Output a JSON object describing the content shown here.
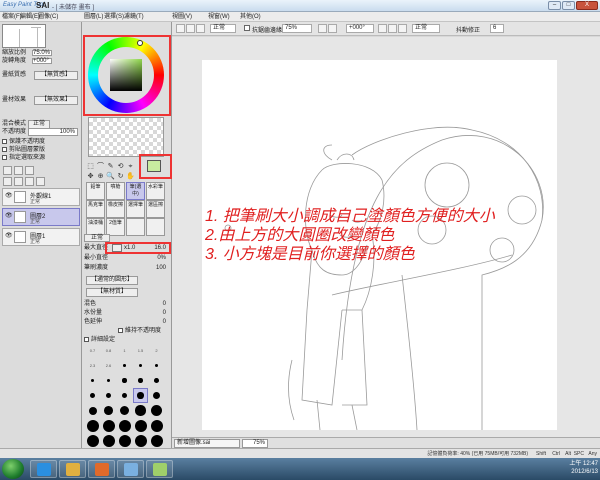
{
  "titlebar": {
    "logo": "Easy Paint Tool",
    "app": "SAI",
    "doc": "- [ 未儲存 畫布 ]",
    "minimize": "–",
    "maximize": "□",
    "close": "X"
  },
  "menu": {
    "items": [
      "檔案(F)",
      "編輯(E)",
      "圖像(C)",
      "圖層(L)",
      "選擇(S)",
      "濾鏡(T)",
      "視圖(V)",
      "視窗(W)",
      "其他(O)"
    ]
  },
  "toolbar": {
    "selection_mode": "正常",
    "antialias_label": "抗鋸齒邊緣",
    "zoom": "75%",
    "angle": "+000°",
    "mode2": "正常",
    "stabilizer_label": "抖動修正",
    "stabilizer_value": "6"
  },
  "left_panel": {
    "nav_zoom_label": "縮放比例",
    "nav_zoom_value": "75.0%",
    "nav_angle_label": "旋轉角度",
    "nav_angle_value": "+000°",
    "paper_texture_label": "畫紙質感",
    "paper_texture_value": "【無質感】",
    "material_label": "畫材效果",
    "material_value": "【無效果】",
    "blend_label": "混合模式",
    "blend_value": "正常",
    "opacity_label": "不透明度",
    "opacity_value": "100%",
    "checkboxes": [
      "保護不透明度",
      "剪貼圖層蒙版",
      "指定選取來源"
    ],
    "layers": [
      {
        "name": "外觀線1",
        "mode": "正常",
        "opacity": "100%"
      },
      {
        "name": "圖層2",
        "mode": "正常",
        "opacity": "100%"
      },
      {
        "name": "圖層1",
        "mode": "正常",
        "opacity": "100%"
      }
    ]
  },
  "tool_panel": {
    "tools": [
      "⬚",
      "⌒",
      "✎",
      "✥",
      "⊕",
      "🔍",
      "↻",
      "✋",
      "⟲",
      "⌖"
    ],
    "brushes": [
      {
        "label": "鉛筆"
      },
      {
        "label": "噴槍"
      },
      {
        "label": "筆(選中)",
        "selected": true
      },
      {
        "label": "水彩筆"
      },
      {
        "label": "馬克筆"
      },
      {
        "label": "橡皮擦"
      },
      {
        "label": "選擇筆"
      },
      {
        "label": "選區擦"
      },
      {
        "label": "油漆桶"
      },
      {
        "label": "2值筆"
      },
      {
        "label": ""
      },
      {
        "label": ""
      }
    ],
    "brush_mode": "正常",
    "max_size_label": "最大直徑",
    "max_size_mult": "x1.0",
    "max_size_value": "16.0",
    "min_size_label": "最小直徑",
    "min_size_value": "0%",
    "density_label": "筆刷濃度",
    "density_value": "100",
    "shape_value": "【通常的圓形】",
    "texture_value": "【無材質】",
    "blend_label": "混色",
    "blend_value": "0",
    "dilution_label": "水份量",
    "dilution_value": "0",
    "persistence_label": "色延伸",
    "persistence_value": "0",
    "keep_opacity_label": "維持不透明度",
    "detail_label": "詳細設定",
    "size_presets": [
      "0.7",
      "0.8",
      "1",
      "1.5",
      "2",
      "2.3",
      "2.6",
      "3",
      "3.5",
      "4",
      "5",
      "6",
      "7",
      "8",
      "9",
      "10",
      "12",
      "14",
      "16",
      "20",
      "25",
      "30",
      "35",
      "40",
      "50",
      "60",
      "70",
      "80",
      "100",
      "120",
      "160",
      "200",
      "250",
      "300",
      "350",
      "400"
    ]
  },
  "instructions": [
    "1. 把筆刷大小調成自己塗顏色方便的大小",
    "2.由上方的大圓圈改變顏色",
    "3. 小方塊是目前你選擇的顏色"
  ],
  "document": {
    "name": "新增圖像.sai",
    "zoom": "75%"
  },
  "status": {
    "memory": "記憶體負荷率: 40% (已用 75MB/可用 732MB)",
    "shift": "Shift",
    "ctrl": "Ctrl",
    "alt": "Alt",
    "spc": "SPC",
    "any": "Any"
  },
  "taskbar": {
    "time": "上午 12:47",
    "date": "2012/6/13"
  },
  "colors": {
    "annotation": "#e02020",
    "foreground": "#c8eca0",
    "selected_layer": "#c8c8ec"
  }
}
